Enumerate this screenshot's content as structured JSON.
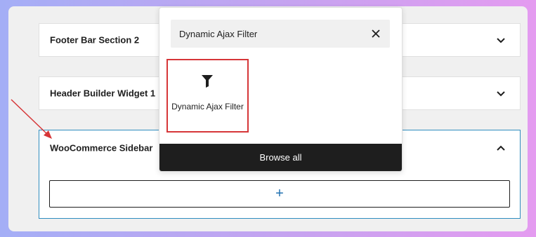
{
  "colors": {
    "accent_blue": "#2f8dbf",
    "highlight_red": "#d63638",
    "browse_bg": "#1e1e1e",
    "add_plus": "#2271b1"
  },
  "panels": [
    {
      "title": "Footer Bar Section 2",
      "icon": "chevron-down-icon",
      "expanded": false
    },
    {
      "title": "Header Builder Widget 1",
      "icon": "chevron-down-icon",
      "expanded": false
    },
    {
      "title": "WooCommerce Sidebar",
      "icon": "chevron-up-icon",
      "expanded": true
    }
  ],
  "add_block": {
    "symbol": "+"
  },
  "inserter": {
    "search": {
      "value": "Dynamic Ajax Filter",
      "clear_icon": "close-icon"
    },
    "results": [
      {
        "icon": "filter-icon",
        "label": "Dynamic Ajax Filter"
      }
    ],
    "browse_all_label": "Browse all"
  }
}
